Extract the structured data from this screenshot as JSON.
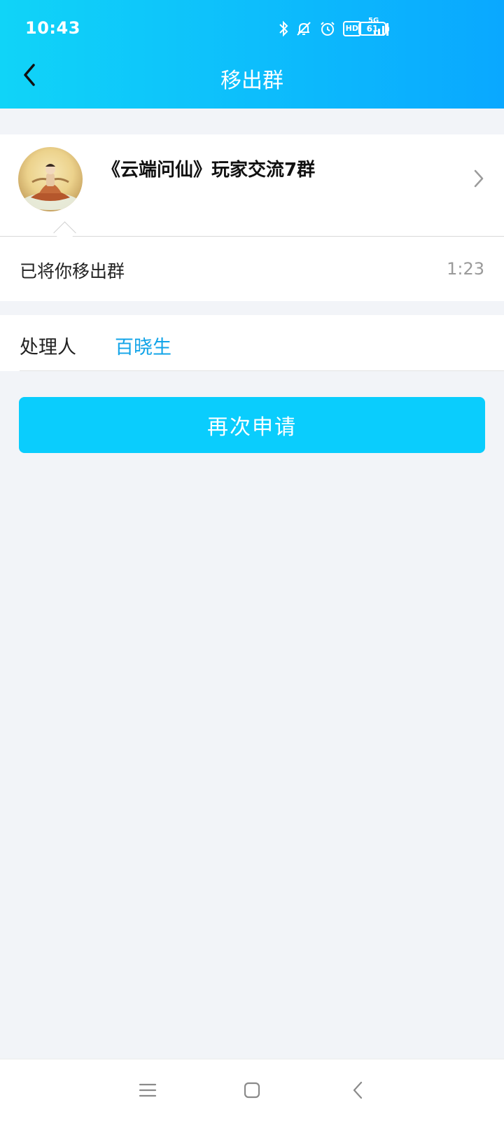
{
  "status_bar": {
    "time": "10:43",
    "network": "5G",
    "hd": "HD",
    "battery": "61",
    "icons": [
      "bluetooth-icon",
      "mute-bell-icon",
      "alarm-icon",
      "hd-icon",
      "signal-5g-icon",
      "battery-icon"
    ]
  },
  "header": {
    "title": "移出群",
    "back_icon": "chevron-left-icon"
  },
  "group": {
    "name": "《云端问仙》玩家交流7群",
    "avatar": "group-avatar",
    "arrow_icon": "chevron-right-icon"
  },
  "message": {
    "text": "已将你移出群",
    "time": "1:23"
  },
  "handler": {
    "label": "处理人",
    "name": "百晓生"
  },
  "actions": {
    "reapply_label": "再次申请"
  },
  "nav_bar": {
    "icons": [
      "menu-icon",
      "home-icon",
      "back-icon"
    ]
  },
  "colors": {
    "header_gradient_start": "#10d4f8",
    "header_gradient_end": "#0aa8ff",
    "button": "#0acdfd",
    "link": "#12a4e8",
    "background": "#f2f4f8"
  }
}
